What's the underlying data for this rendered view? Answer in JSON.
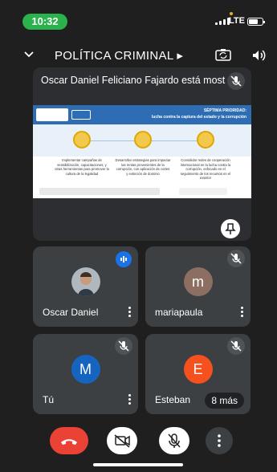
{
  "status_bar": {
    "time": "10:32",
    "network": "LTE"
  },
  "header": {
    "meeting_title": "POLÍTICA CRIMINAL ▸"
  },
  "presentation": {
    "label": "Oscar Daniel Feliciano Fajardo está most",
    "slide": {
      "title_line1": "SÉPTIMA PRIORIDAD:",
      "title_line2": "lucha contra la captura del estado y la corrupción",
      "col1": "Implementar campañas de sensibilización, capacitaciones, y otras herramientas para promover la cultura de la legalidad",
      "col2": "Desarrollar estrategias para impactar las rentas provenientes de la corrupción, con aplicación de cortes y extinción de dominio",
      "col3": "Consolidar redes de cooperación internacional en la lucha contra la corrupción, enfocado en el seguimiento de los recursos en el exterior"
    }
  },
  "participants": [
    {
      "name": "Oscar Daniel",
      "avatar": "photo",
      "color": "#6b7a86",
      "speaking": true
    },
    {
      "name": "mariapaula",
      "avatar": "m",
      "color": "#8d6e63",
      "speaking": false
    },
    {
      "name": "Tú",
      "avatar": "M",
      "color": "#1565c0",
      "speaking": false
    },
    {
      "name": "Esteban",
      "avatar": "E",
      "color": "#f4511e",
      "speaking": false,
      "badge": "8 más"
    }
  ],
  "colors": {
    "end_call": "#ea4335",
    "speaking": "#1a73e8",
    "tile_bg": "#3c4043"
  }
}
